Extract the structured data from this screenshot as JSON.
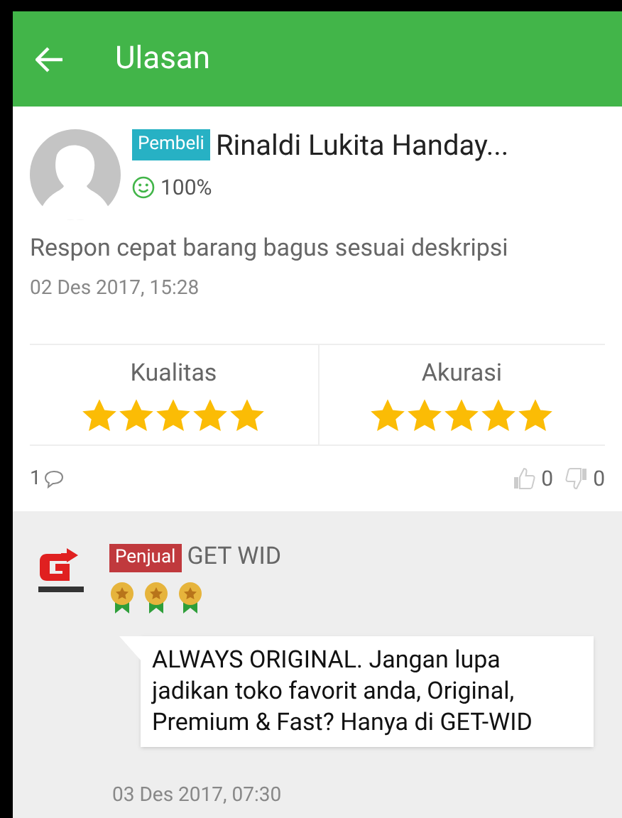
{
  "header": {
    "title": "Ulasan"
  },
  "review": {
    "badge": "Pembeli",
    "name": "Rinaldi Lukita Handay...",
    "satisfaction": "100%",
    "text": "Respon cepat barang bagus sesuai deskripsi",
    "date": "02 Des 2017, 15:28",
    "ratings": [
      {
        "label": "Kualitas",
        "stars": 5
      },
      {
        "label": "Akurasi",
        "stars": 5
      }
    ],
    "comments": "1",
    "likes": "0",
    "dislikes": "0"
  },
  "reply": {
    "badge": "Penjual",
    "name": "GET WID",
    "reputation": {
      "stars": 3
    },
    "text": "ALWAYS ORIGINAL. Jangan lupa jadikan toko favorit anda, Original, Premium & Fast? Hanya di GET-WID",
    "date": "03 Des 2017, 07:30"
  }
}
